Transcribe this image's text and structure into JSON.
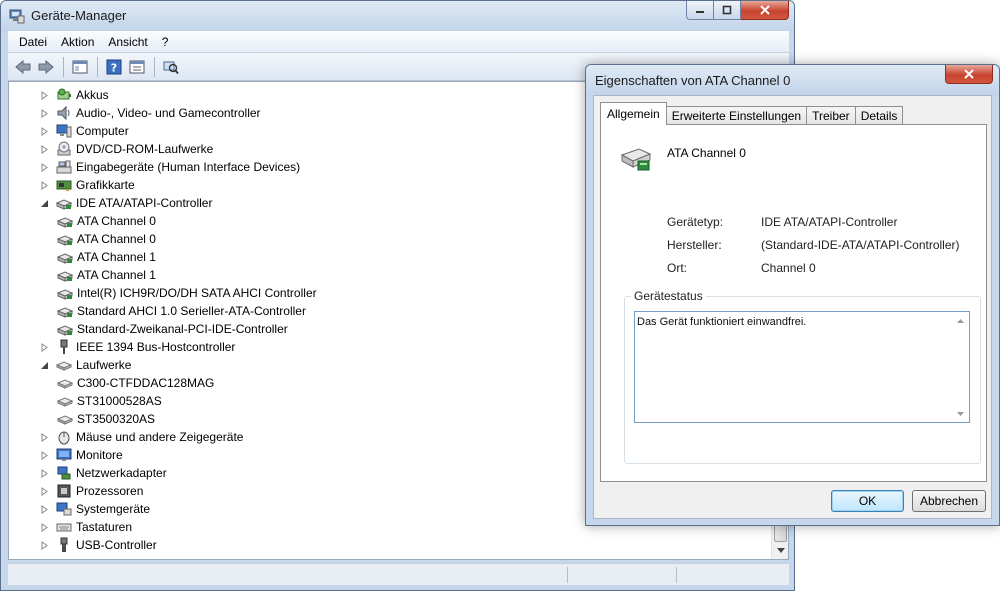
{
  "main_window": {
    "title": "Geräte-Manager",
    "menu": [
      {
        "label": "Datei",
        "name": "menu-datei"
      },
      {
        "label": "Aktion",
        "name": "menu-aktion"
      },
      {
        "label": "Ansicht",
        "name": "menu-ansicht"
      },
      {
        "label": "?",
        "name": "menu-help"
      }
    ],
    "toolbar": [
      "back-icon",
      "forward-icon",
      "show-hide-console-tree-icon",
      "help-icon",
      "properties-icon",
      "scan-hardware-icon"
    ],
    "tree": [
      {
        "label": "Akkus",
        "level": 0,
        "state": "collapsed",
        "icon": "battery-icon"
      },
      {
        "label": "Audio-, Video- und Gamecontroller",
        "level": 0,
        "state": "collapsed",
        "icon": "speaker-icon"
      },
      {
        "label": "Computer",
        "level": 0,
        "state": "collapsed",
        "icon": "computer-icon"
      },
      {
        "label": "DVD/CD-ROM-Laufwerke",
        "level": 0,
        "state": "collapsed",
        "icon": "optical-drive-icon"
      },
      {
        "label": "Eingabegeräte (Human Interface Devices)",
        "level": 0,
        "state": "collapsed",
        "icon": "hid-icon"
      },
      {
        "label": "Grafikkarte",
        "level": 0,
        "state": "collapsed",
        "icon": "display-adapter-icon"
      },
      {
        "label": "IDE ATA/ATAPI-Controller",
        "level": 0,
        "state": "expanded",
        "icon": "ide-controller-icon"
      },
      {
        "label": "ATA Channel 0",
        "level": 1,
        "state": "none",
        "icon": "ide-controller-icon"
      },
      {
        "label": "ATA Channel 0",
        "level": 1,
        "state": "none",
        "icon": "ide-controller-icon"
      },
      {
        "label": "ATA Channel 1",
        "level": 1,
        "state": "none",
        "icon": "ide-controller-icon"
      },
      {
        "label": "ATA Channel 1",
        "level": 1,
        "state": "none",
        "icon": "ide-controller-icon"
      },
      {
        "label": "Intel(R) ICH9R/DO/DH SATA AHCI Controller",
        "level": 1,
        "state": "none",
        "icon": "ide-controller-icon"
      },
      {
        "label": "Standard AHCI 1.0 Serieller-ATA-Controller",
        "level": 1,
        "state": "none",
        "icon": "ide-controller-icon"
      },
      {
        "label": "Standard-Zweikanal-PCI-IDE-Controller",
        "level": 1,
        "state": "none",
        "icon": "ide-controller-icon"
      },
      {
        "label": "IEEE 1394 Bus-Hostcontroller",
        "level": 0,
        "state": "collapsed",
        "icon": "firewire-icon"
      },
      {
        "label": "Laufwerke",
        "level": 0,
        "state": "expanded",
        "icon": "disk-drive-icon"
      },
      {
        "label": "C300-CTFDDAC128MAG",
        "level": 1,
        "state": "none",
        "icon": "disk-drive-icon"
      },
      {
        "label": "ST31000528AS",
        "level": 1,
        "state": "none",
        "icon": "disk-drive-icon"
      },
      {
        "label": "ST3500320AS",
        "level": 1,
        "state": "none",
        "icon": "disk-drive-icon"
      },
      {
        "label": "Mäuse und andere Zeigegeräte",
        "level": 0,
        "state": "collapsed",
        "icon": "mouse-icon"
      },
      {
        "label": "Monitore",
        "level": 0,
        "state": "collapsed",
        "icon": "monitor-icon"
      },
      {
        "label": "Netzwerkadapter",
        "level": 0,
        "state": "collapsed",
        "icon": "network-adapter-icon"
      },
      {
        "label": "Prozessoren",
        "level": 0,
        "state": "collapsed",
        "icon": "processor-icon"
      },
      {
        "label": "Systemgeräte",
        "level": 0,
        "state": "collapsed",
        "icon": "system-devices-icon"
      },
      {
        "label": "Tastaturen",
        "level": 0,
        "state": "collapsed",
        "icon": "keyboard-icon"
      },
      {
        "label": "USB-Controller",
        "level": 0,
        "state": "collapsed",
        "icon": "usb-icon"
      }
    ]
  },
  "dialog": {
    "title": "Eigenschaften von ATA Channel 0",
    "tabs": [
      {
        "label": "Allgemein",
        "active": true
      },
      {
        "label": "Erweiterte Einstellungen",
        "active": false
      },
      {
        "label": "Treiber",
        "active": false
      },
      {
        "label": "Details",
        "active": false
      }
    ],
    "device_name": "ATA Channel 0",
    "properties": [
      {
        "label": "Gerätetyp:",
        "value": "IDE ATA/ATAPI-Controller"
      },
      {
        "label": "Hersteller:",
        "value": "(Standard-IDE-ATA/ATAPI-Controller)"
      },
      {
        "label": "Ort:",
        "value": "Channel 0"
      }
    ],
    "status_group_label": "Gerätestatus",
    "status_text": "Das Gerät funktioniert einwandfrei.",
    "ok_label": "OK",
    "cancel_label": "Abbrechen"
  },
  "colors": {
    "frame": "#c6d7ec",
    "close_button": "#c7432f",
    "default_button_border": "#3c7fb1",
    "status_box_border": "#7a9cc9"
  }
}
